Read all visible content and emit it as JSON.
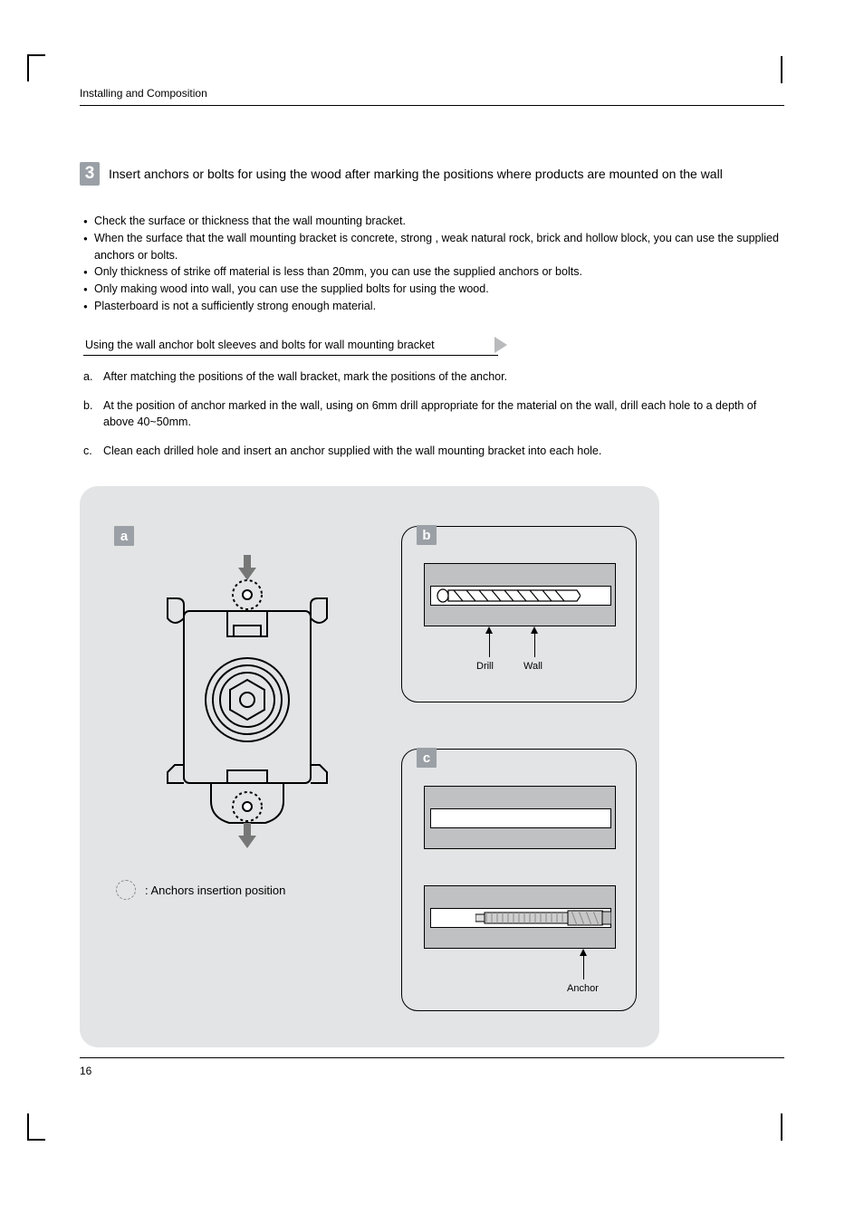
{
  "header": {
    "section": "Installing and Composition"
  },
  "step": {
    "number": "3",
    "title": "Insert anchors or bolts for using the wood after marking the positions where products are mounted on the wall"
  },
  "bullets": [
    "Check the surface or thickness that the wall mounting bracket.",
    "When the surface that the wall mounting bracket is concrete, strong , weak natural rock, brick and hollow block, you can use the supplied anchors or bolts.",
    "Only thickness of strike off material is less than 20mm, you can use the supplied anchors or bolts.",
    "Only making wood into wall, you can use the  supplied bolts for using the wood.",
    "Plasterboard is not a sufficiently strong enough material."
  ],
  "subheading": "Using the wall anchor bolt sleeves and bolts for wall mounting bracket",
  "lettered": [
    {
      "label": "a.",
      "text": "After matching the positions of the wall bracket, mark the positions of the anchor."
    },
    {
      "label": "b.",
      "text": "At the position of anchor marked in the wall, using on 6mm drill appropriate for the material on the wall, drill each hole to a depth of above 40~50mm."
    },
    {
      "label": "c.",
      "text": "Clean each drilled hole and insert an anchor supplied with the wall mounting bracket into each hole."
    }
  ],
  "figures": {
    "a_badge": "a",
    "a_legend": ": Anchors insertion position",
    "b_badge": "b",
    "b_labels": {
      "drill": "Drill",
      "wall": "Wall"
    },
    "c_badge": "c",
    "c_labels": {
      "anchor": "Anchor"
    }
  },
  "page_number": "16"
}
